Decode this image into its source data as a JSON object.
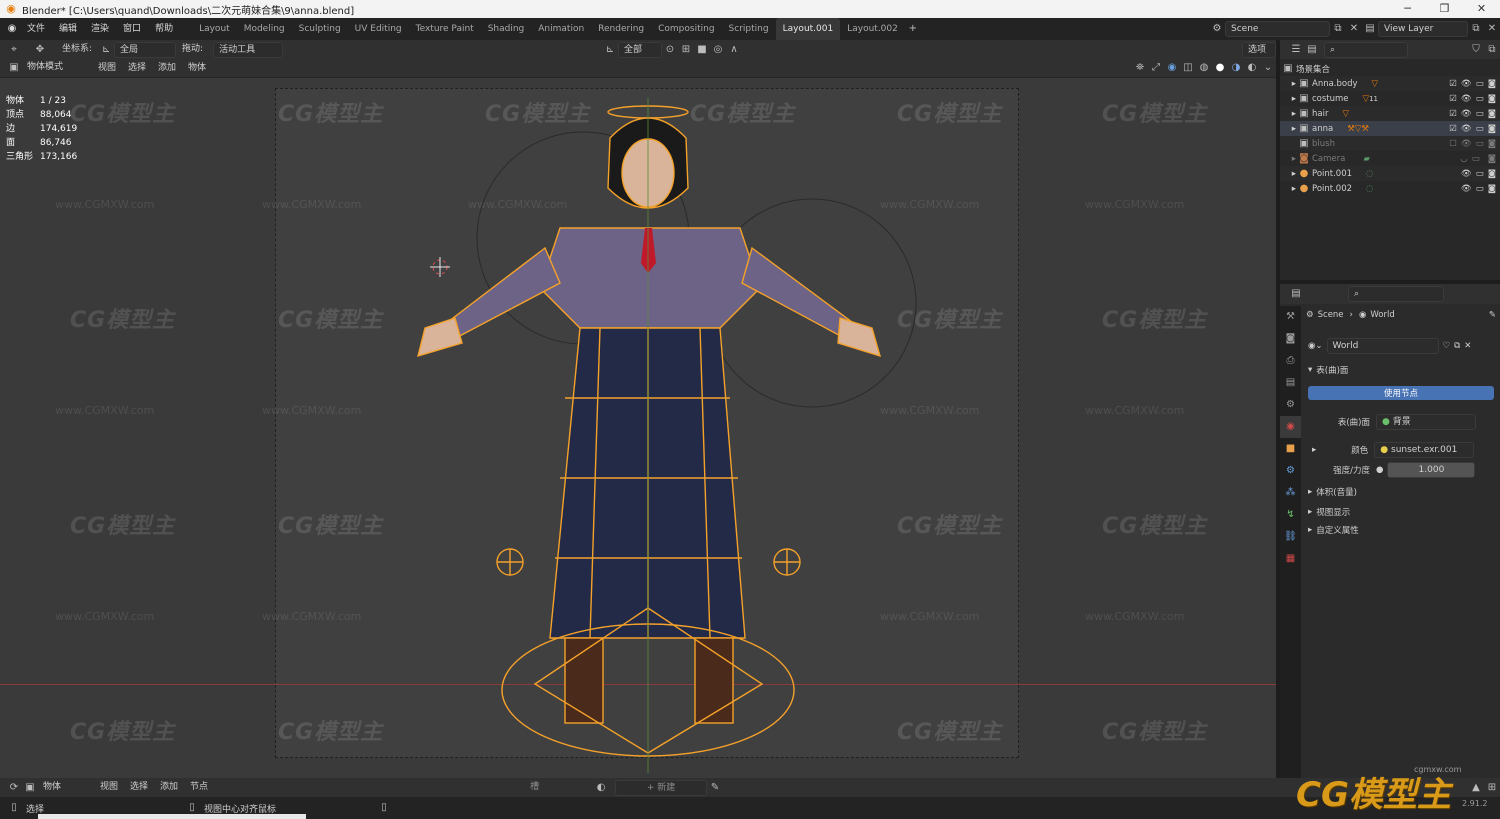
{
  "window": {
    "title": "Blender* [C:\\Users\\quand\\Downloads\\二次元萌妹合集\\9\\anna.blend]"
  },
  "menu": [
    "文件",
    "编辑",
    "渲染",
    "窗口",
    "帮助"
  ],
  "workspaces": [
    "Layout",
    "Modeling",
    "Sculpting",
    "UV Editing",
    "Texture Paint",
    "Shading",
    "Animation",
    "Rendering",
    "Compositing",
    "Scripting",
    "Layout.001",
    "Layout.002"
  ],
  "active_workspace": "Layout.001",
  "scene": {
    "label": "Scene",
    "view_layer": "View Layer"
  },
  "header1": {
    "coord_label": "坐标系:",
    "coord_value": "全局",
    "drag_label": "拖动:",
    "drag_value": "活动工具",
    "pivot_value": "全部",
    "options": "选项"
  },
  "header2": {
    "mode": "物体模式",
    "items": [
      "视图",
      "选择",
      "添加",
      "物体"
    ]
  },
  "stats": [
    {
      "label": "物体",
      "value": "1 / 23"
    },
    {
      "label": "顶点",
      "value": "88,064"
    },
    {
      "label": "边",
      "value": "174,619"
    },
    {
      "label": "面",
      "value": "86,746"
    },
    {
      "label": "三角形",
      "value": "173,166"
    }
  ],
  "watermark": {
    "logo": "CG模型主",
    "url": "www.CGMXW.com"
  },
  "outliner": {
    "root": "场景集合",
    "items": [
      "Anna.body",
      "costume",
      "hair",
      "anna",
      "blush",
      "Camera",
      "Point.001",
      "Point.002"
    ],
    "modifier_badge": "11"
  },
  "properties": {
    "breadcrumb_scene": "Scene",
    "breadcrumb_world": "World",
    "world_name": "World",
    "surface_section": "表(曲)面",
    "use_nodes": "使用节点",
    "surface_label": "表(曲)面",
    "surface_value": "背景",
    "color_label": "颜色",
    "color_value": "sunset.exr.001",
    "strength_label": "强度/力度",
    "strength_value": "1.000",
    "sections": [
      "体积(音量)",
      "视图显示",
      "自定义属性"
    ]
  },
  "timeline": {
    "mode": "物体",
    "items": [
      "视图",
      "选择",
      "添加",
      "节点"
    ],
    "slot": "槽",
    "new": "新建"
  },
  "status": {
    "select": "选择",
    "center": "视图中心对齐鼠标"
  },
  "corner_logo": {
    "text": "CG模型主",
    "url": "cgmxw.com",
    "version": "2.91.2"
  },
  "colors": {
    "accent": "#e87d0d",
    "wire": "#f4a12a",
    "active_tab": "#4772b3"
  }
}
